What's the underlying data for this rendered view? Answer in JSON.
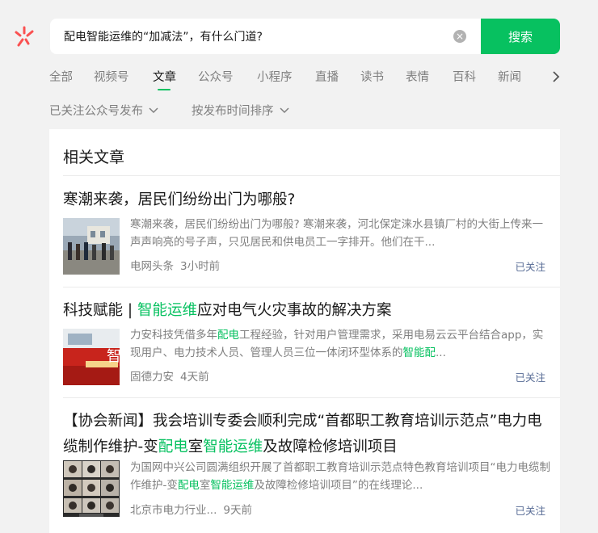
{
  "search": {
    "query": "配电智能运维的“加减法”，有什么门道?",
    "button_label": "搜索",
    "clear_glyph": "×"
  },
  "tabs": [
    {
      "label": "全部"
    },
    {
      "label": "视频号"
    },
    {
      "label": "文章"
    },
    {
      "label": "公众号"
    },
    {
      "label": "小程序"
    },
    {
      "label": "直播"
    },
    {
      "label": "读书"
    },
    {
      "label": "表情"
    },
    {
      "label": "百科"
    },
    {
      "label": "新闻"
    }
  ],
  "active_tab": "文章",
  "filters": [
    {
      "label": "已关注公众号发布"
    },
    {
      "label": "按发布时间排序"
    }
  ],
  "results": {
    "section_title": "相关文章",
    "articles": [
      {
        "title": [
          {
            "text": "寒潮来袭，居民们纷纷出门为哪般?"
          }
        ],
        "desc": [
          {
            "text": "寒潮来袭，居民们纷纷出门为哪般? 寒潮来袭，河北保定涞水县镇厂村的大街上传来一声声响亮的号子声，只见居民和供电员工一字排开。他们在干..."
          }
        ],
        "source": "电网头条",
        "time": "3小时前",
        "follow_label": "已关注",
        "thumb_alt": "street-photo-thumbnail"
      },
      {
        "title": [
          {
            "text": "科技赋能 | "
          },
          {
            "text": "智能运维",
            "hl": true
          },
          {
            "text": "应对电气火灾事故的解决方案"
          }
        ],
        "desc": [
          {
            "text": "力安科技凭借多年"
          },
          {
            "text": "配电",
            "hl": true
          },
          {
            "text": "工程经验，针对用户管理需求，采用电易云云平台结合app，实现用户、电力技术人员、管理人员三位一体闭环型体系的"
          },
          {
            "text": "智能配",
            "hl": true
          },
          {
            "text": "..."
          }
        ],
        "source": "固德力安",
        "time": "4天前",
        "follow_label": "已关注",
        "thumb_alt": "red-banner-thumbnail",
        "thumb_text": "智"
      },
      {
        "title": [
          {
            "text": "【协会新闻】我会培训专委会顺利完成“首都职工教育培训示范点”电力电缆制作维护-变"
          },
          {
            "text": "配电",
            "hl": true
          },
          {
            "text": "室"
          },
          {
            "text": "智能运维",
            "hl": true
          },
          {
            "text": "及故障检修培训项目"
          }
        ],
        "desc": [
          {
            "text": "为国网中兴公司圆满组织开展了首都职工教育培训示范点特色教育培训项目“电力电缆制作维护-变"
          },
          {
            "text": "配电",
            "hl": true
          },
          {
            "text": "室"
          },
          {
            "text": "智能运维",
            "hl": true
          },
          {
            "text": "及故障检修培训项目”的在线理论..."
          }
        ],
        "source": "北京市电力行业...",
        "time": "9天前",
        "follow_label": "已关注",
        "thumb_alt": "video-conference-thumbnail"
      }
    ]
  },
  "colors": {
    "accent": "#07c160",
    "link": "#576b95",
    "muted": "#7f7f7f",
    "logo_red": "#fa5151"
  }
}
